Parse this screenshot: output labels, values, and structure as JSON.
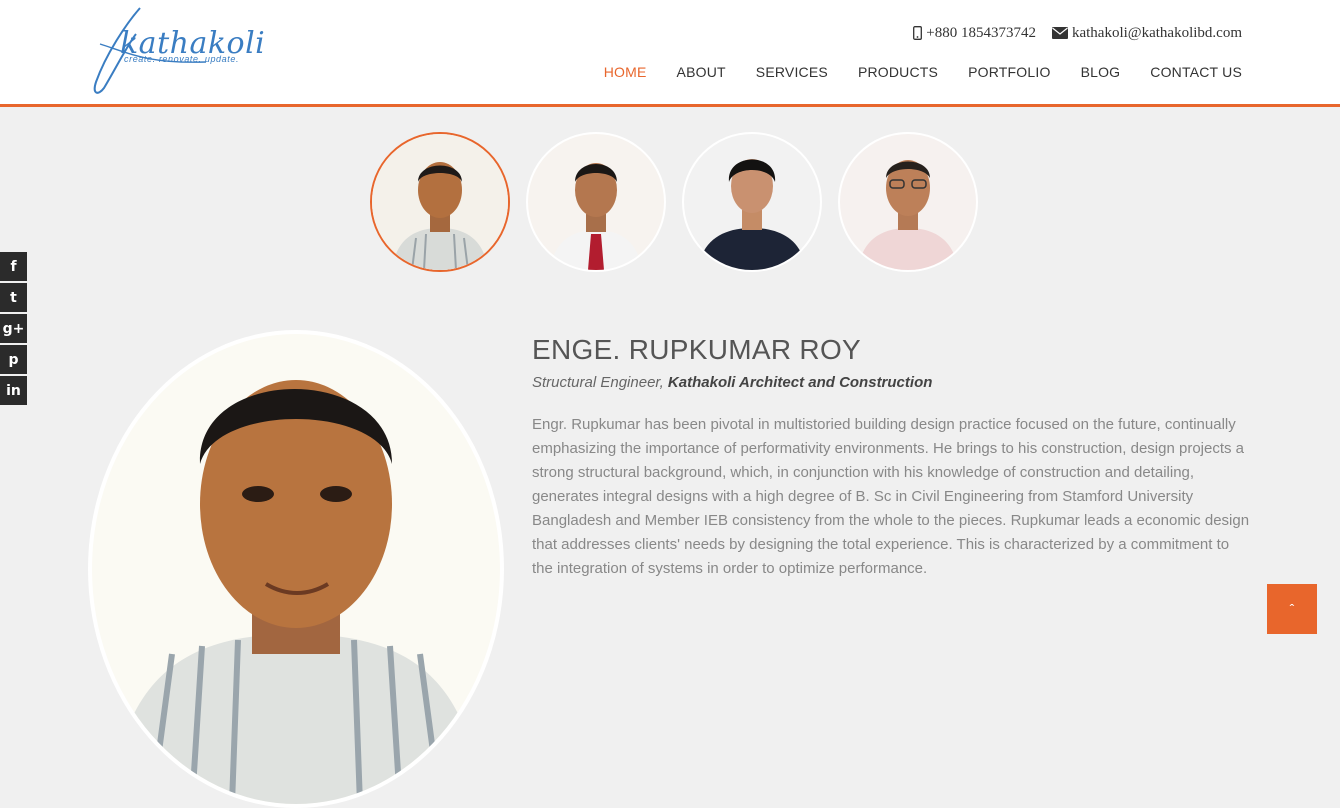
{
  "brand": {
    "name": "kathakoli",
    "tagline": "create. renovate. update.",
    "color": "#3a7dc2"
  },
  "contact": {
    "phone_icon": "mobile-phone-icon",
    "phone": "+880 1854373742",
    "email_icon": "envelope-icon",
    "email": "kathakoli@kathakolibd.com"
  },
  "nav": {
    "items": [
      {
        "label": "HOME",
        "active": true
      },
      {
        "label": "ABOUT"
      },
      {
        "label": "SERVICES"
      },
      {
        "label": "PRODUCTS"
      },
      {
        "label": "PORTFOLIO"
      },
      {
        "label": "BLOG"
      },
      {
        "label": "CONTACT US"
      }
    ]
  },
  "accent_color": "#e8662c",
  "team_thumbnails": [
    {
      "selected": true
    },
    {
      "selected": false
    },
    {
      "selected": false
    },
    {
      "selected": false
    }
  ],
  "social": [
    {
      "icon": "facebook-icon",
      "glyph": "f"
    },
    {
      "icon": "twitter-icon",
      "glyph": "t"
    },
    {
      "icon": "google-plus-icon",
      "glyph": "g+"
    },
    {
      "icon": "pinterest-icon",
      "glyph": "p"
    },
    {
      "icon": "linkedin-icon",
      "glyph": "in"
    }
  ],
  "profile": {
    "name": "ENGE. RUPKUMAR ROY",
    "role_prefix": "Structural Engineer, ",
    "company": "Kathakoli Architect and Construction",
    "bio": "Engr. Rupkumar has been pivotal in multistoried building design practice focused on the future, continually emphasizing the importance of performativity environments. He brings to his construction, design projects a strong structural background, which, in conjunction with his knowledge of construction and detailing, generates integral designs with a high degree of B. Sc in Civil Engineering from Stamford University Bangladesh and Member IEB consistency from the whole to the pieces. Rupkumar leads a economic design that addresses clients' needs by designing the total experience. This is characterized by a commitment to the integration of systems in order to optimize performance."
  },
  "back_to_top": {
    "icon": "chevron-up-icon",
    "glyph": "ˆ"
  }
}
